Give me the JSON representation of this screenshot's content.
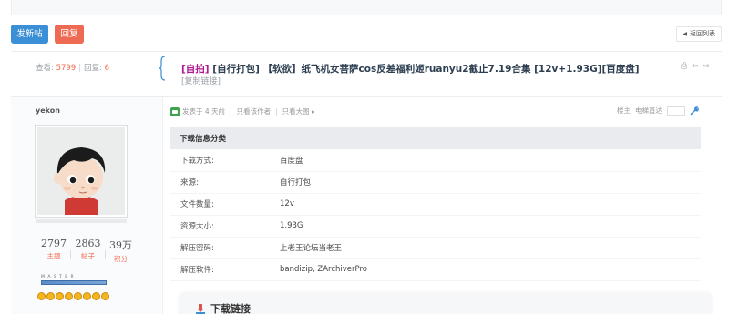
{
  "toolbar": {
    "post_label": "发新帖",
    "reply_label": "回复",
    "back_label": "返回列表"
  },
  "thread": {
    "stats": {
      "views_label": "查看:",
      "views": "5799",
      "replies_label": "回复:",
      "replies": "6"
    },
    "title_tag": "[自拍]",
    "title_text": " [自行打包] 【软欲】纸飞机女菩萨cos反差福利姬ruanyu2截止7.19合集 [12v+1.93G][百度盘]",
    "copy_link": "[复制链接]",
    "tools": "⎙ ⇦ ⇨"
  },
  "author": {
    "name": "yekon",
    "stats": [
      {
        "value": "2797",
        "label": "主题"
      },
      {
        "value": "2863",
        "label": "帖子"
      },
      {
        "value": "39万",
        "label": "积分"
      }
    ],
    "rank": "M A S T E R",
    "medal_count": 8
  },
  "post": {
    "meta": {
      "posted": "发表于 4 天前",
      "only_author": "只看该作者",
      "only_images": "只看大图 ▸"
    },
    "floor": {
      "label": "楼主",
      "jump": "电梯直达"
    }
  },
  "download": {
    "header": "下载信息分类",
    "rows": [
      {
        "key": "下载方式:",
        "value": "百度盘"
      },
      {
        "key": "来源:",
        "value": "自行打包"
      },
      {
        "key": "文件数量:",
        "value": "12v"
      },
      {
        "key": "资源大小:",
        "value": "1.93G"
      },
      {
        "key": "解压密码:",
        "value": "上老王论坛当老王"
      },
      {
        "key": "解压软件:",
        "value": "bandizip, ZArchiverPro"
      }
    ],
    "link_title": "下载链接"
  },
  "colors": {
    "accent_blue": "#3a8fd6",
    "reply_red": "#ee6a52",
    "title_tag": "#b0198f",
    "stat_num": "#ef6a4c"
  }
}
